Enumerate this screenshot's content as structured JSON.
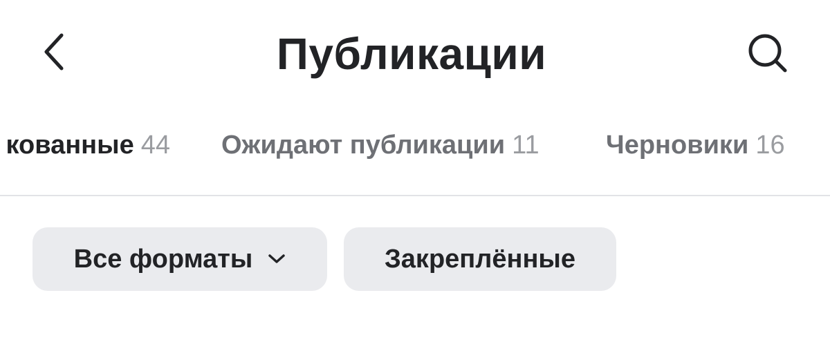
{
  "header": {
    "title": "Публикации",
    "back_icon": "chevron-left-icon",
    "search_icon": "search-icon"
  },
  "tabs": [
    {
      "label": "кованные",
      "count": "44",
      "active": true
    },
    {
      "label": "Ожидают публикации",
      "count": "11",
      "active": false
    },
    {
      "label": "Черновики",
      "count": "16",
      "active": false
    }
  ],
  "filters": {
    "formats_label": "Все форматы",
    "formats_icon": "chevron-down-icon",
    "pinned_label": "Закреплённые"
  },
  "colors": {
    "text_primary": "#222326",
    "text_secondary": "#6e7075",
    "count": "#9a9ca0",
    "chip_bg": "#eaebee",
    "divider": "#e2e3e6"
  }
}
